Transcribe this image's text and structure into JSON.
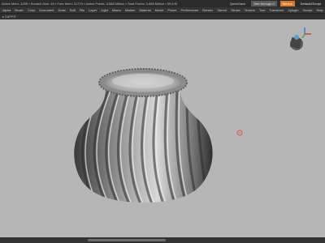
{
  "titlebar": {
    "stats": "Active Mem: 3295 ▪ Scratch Disk: 49 ▪ Free Mem: 31770 ▪ Active Points: 3.888 Million ▪ Total Points: 3.888 Million ▪ 59.6 M",
    "quicksave": "QuickSave",
    "seethrough": "See-through  0",
    "menus": "Menus",
    "default_script": "DefaultZScript"
  },
  "menubar": {
    "items": [
      "Alpha",
      "Brush",
      "Color",
      "Document",
      "Draw",
      "Edit",
      "File",
      "Layer",
      "Light",
      "Macro",
      "Marker",
      "Material",
      "Movie",
      "Picker",
      "Preferences",
      "Render",
      "Stencil",
      "Stroke",
      "Texture",
      "Tool",
      "Transform",
      "Zplugin",
      "Zscript",
      "Help"
    ]
  },
  "subbar": {
    "label": "▸ ZAPPIT"
  },
  "viewport": {
    "background": "#b6b6b6",
    "model": "vase-3d-model",
    "navigation_gizmo": "navigation-cube-gizmo"
  },
  "colors": {
    "accent": "#d87a2a",
    "cursor": "#e05050"
  }
}
